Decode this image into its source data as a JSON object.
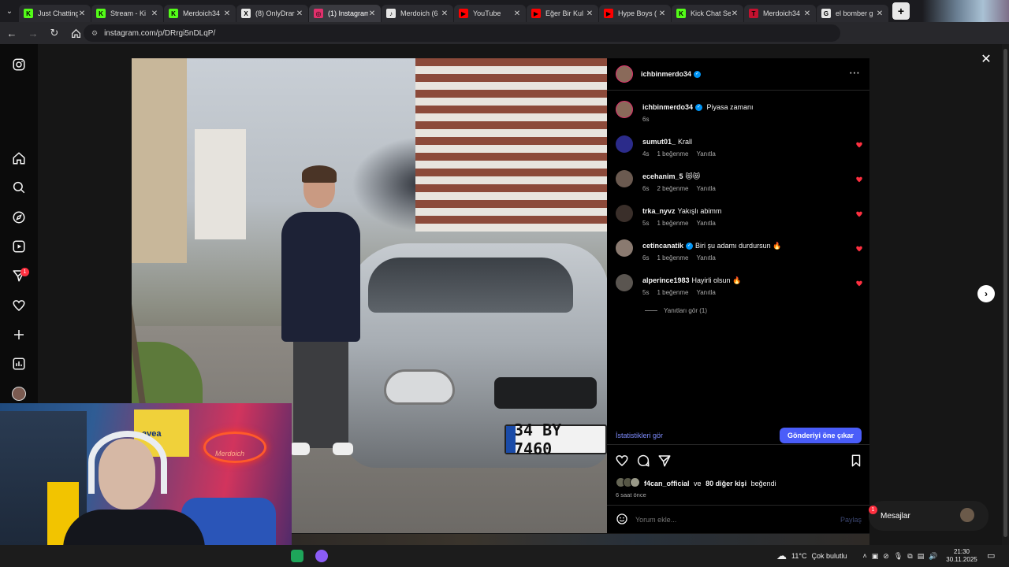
{
  "browser": {
    "tabs": [
      {
        "label": "Just Chatting",
        "fav_color": "#53fc18",
        "fav": "K"
      },
      {
        "label": "Stream - Ki",
        "fav_color": "#53fc18",
        "fav": "K"
      },
      {
        "label": "Merdoich34",
        "fav_color": "#53fc18",
        "fav": "K"
      },
      {
        "label": "(8) OnlyDrar",
        "fav_color": "#e6e6e6",
        "fav": "X"
      },
      {
        "label": "(1) Instagram",
        "fav_color": "#e1306c",
        "fav": "◎",
        "active": true
      },
      {
        "label": "Merdoich (6",
        "fav_color": "#e6e6e6",
        "fav": "♪"
      },
      {
        "label": "YouTube",
        "fav_color": "#ff0000",
        "fav": "▶"
      },
      {
        "label": "Eğer Bir Kul",
        "fav_color": "#ff0000",
        "fav": "▶"
      },
      {
        "label": "Hype Boys (",
        "fav_color": "#ff0000",
        "fav": "▶"
      },
      {
        "label": "Kick Chat Se",
        "fav_color": "#53fc18",
        "fav": "K"
      },
      {
        "label": "Merdoich34",
        "fav_color": "#c4112f",
        "fav": "T"
      },
      {
        "label": "el bomber g",
        "fav_color": "#e6e6e6",
        "fav": "G"
      }
    ],
    "url": "instagram.com/p/DRrgi5nDLqP/"
  },
  "post": {
    "author": "ichbinmerdo34",
    "caption_author": "ichbinmerdo34",
    "caption": "Piyasa zamanı",
    "caption_time": "6s",
    "comments": [
      {
        "user": "sumut01_",
        "text": "Krall",
        "time": "4s",
        "likes": "1 beğenme",
        "reply": "Yanıtla",
        "avatar": "#2b2b8a",
        "verified": false
      },
      {
        "user": "ecehanim_5",
        "text": "😻😻",
        "time": "6s",
        "likes": "2 beğenme",
        "reply": "Yanıtla",
        "avatar": "#6b5a50",
        "verified": false
      },
      {
        "user": "trka_nyvz",
        "text": "Yakışlı abimm",
        "time": "5s",
        "likes": "1 beğenme",
        "reply": "Yanıtla",
        "avatar": "#3a2f2a",
        "verified": false
      },
      {
        "user": "cetincanatik",
        "text": "Biri şu adamı durdursun 🔥",
        "time": "6s",
        "likes": "1 beğenme",
        "reply": "Yanıtla",
        "avatar": "#8a7a70",
        "verified": true
      },
      {
        "user": "alperince1983",
        "text": "Hayirli olsun 🔥",
        "time": "5s",
        "likes": "1 beğenme",
        "reply": "Yanıtla",
        "avatar": "#5a5550",
        "verified": false
      }
    ],
    "view_replies": "Yanıtları gör (1)",
    "stats_link": "İstatistikleri gör",
    "boost_button": "Gönderiyi öne çıkar",
    "liked_by_user": "f4can_official",
    "liked_by_and": "ve",
    "liked_by_others": "80 diğer kişi",
    "liked_by_suffix": "beğendi",
    "post_time": "6 saat önce",
    "comment_placeholder": "Yorum ekle...",
    "share_label": "Paylaş",
    "plate": "34 BY 7460"
  },
  "sidebar": {
    "notification_count": "1"
  },
  "messages": {
    "label": "Mesajlar",
    "badge": "1"
  },
  "webcam": {
    "poster_text": "avea",
    "neon_text": "Merdoich"
  },
  "taskbar": {
    "weather": "11°C",
    "weather_desc": "Çok bulutlu",
    "time": "21:30",
    "date": "30.11.2025"
  },
  "colors": {
    "accent_blue": "#4a5df9",
    "verified": "#0095f6",
    "like_red": "#ff3040"
  }
}
